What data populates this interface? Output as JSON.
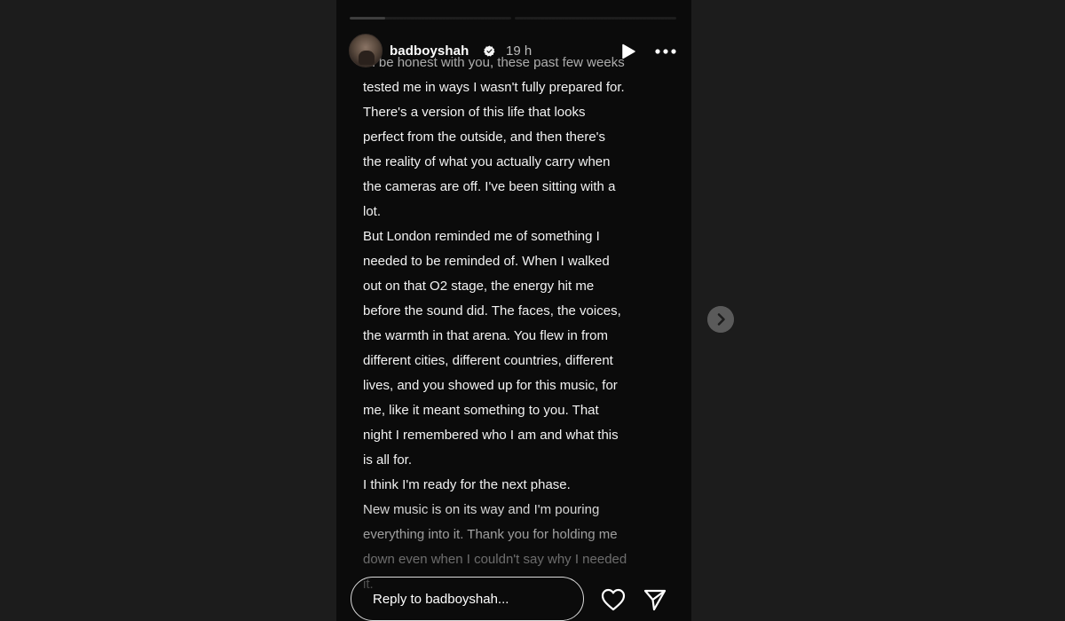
{
  "story": {
    "progress": [
      {
        "segment": 1,
        "filled_fraction": 0.22
      },
      {
        "segment": 2,
        "filled_fraction": 0
      }
    ],
    "username": "badboyshah",
    "verified": true,
    "time": "19 h",
    "reply_placeholder": "Reply to badboyshah...",
    "icons": {
      "avatar": "profile-photo",
      "verified": "verified-badge-icon",
      "play": "play-icon",
      "more": "more-options-icon",
      "like": "heart-icon",
      "share": "send-icon",
      "next": "chevron-right-icon"
    },
    "text_lines": [
      "I'll be honest with you, these past few weeks",
      "tested me in ways I wasn't fully prepared for.",
      "There's a version of this life that looks",
      "perfect from the outside, and then there's",
      "the reality of what you actually carry when",
      "the cameras are off. I've been sitting with a",
      "lot.",
      "But London reminded me of something I",
      "needed to be reminded of. When I walked",
      "out on that O2 stage, the energy hit me",
      "before the sound did. The faces, the voices,",
      "the warmth in that arena. You flew in from",
      "different cities, different countries, different",
      "lives, and you showed up for this music, for",
      "me, like it meant something to you. That",
      "night I remembered who I am and what this",
      "is all for.",
      "I think I'm ready for the next phase.",
      "New music is on its way and I'm pouring",
      "everything into it. Thank you for holding me",
      "down even when I couldn't say why I needed",
      "it."
    ]
  },
  "colors": {
    "page_bg": "#1c1c1c",
    "story_bg": "#0b0b0b",
    "text": "#f2f2f2",
    "verified_blue": "#3897f0"
  }
}
